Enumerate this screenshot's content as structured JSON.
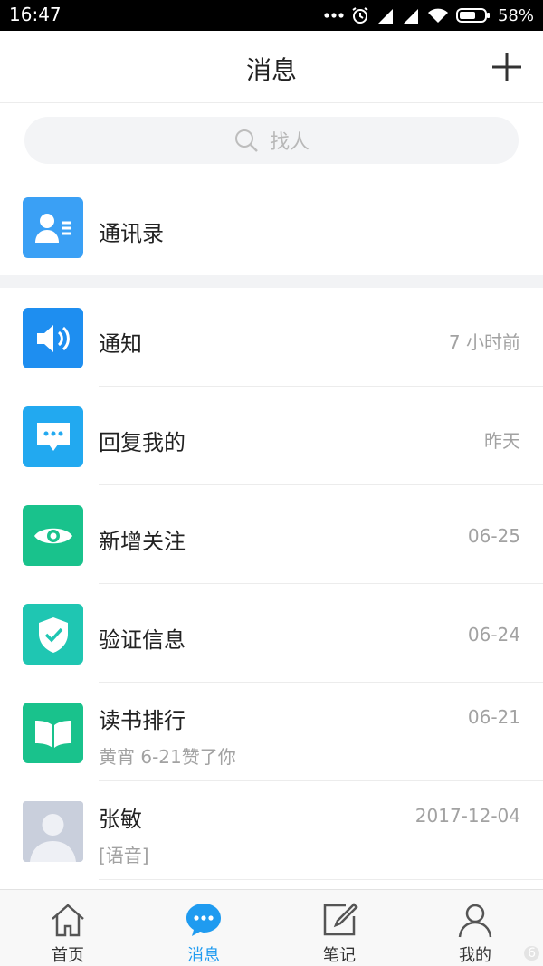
{
  "status_bar": {
    "time": "16:47",
    "battery": "58%"
  },
  "header": {
    "title": "消息",
    "add_icon": "plus-icon"
  },
  "search": {
    "placeholder": "找人",
    "icon": "search-icon"
  },
  "contacts": {
    "label": "通讯录",
    "icon": "contact-card-icon",
    "icon_color": "#3aa0f5"
  },
  "messages": [
    {
      "title": "通知",
      "time": "7 小时前",
      "icon": "speaker-icon",
      "icon_color": "#1e8ef0"
    },
    {
      "title": "回复我的",
      "time": "昨天",
      "icon": "chat-bubble-icon",
      "icon_color": "#22a9f0"
    },
    {
      "title": "新增关注",
      "time": "06-25",
      "icon": "eye-icon",
      "icon_color": "#19c28c"
    },
    {
      "title": "验证信息",
      "time": "06-24",
      "icon": "shield-check-icon",
      "icon_color": "#1fc6b2"
    },
    {
      "title": "读书排行",
      "time": "06-21",
      "subtitle": "黄宵 6-21赞了你",
      "icon": "book-icon",
      "icon_color": "#19c28c"
    },
    {
      "title": "张敏",
      "time": "2017-12-04",
      "subtitle": "[语音]",
      "icon": "avatar-placeholder-icon",
      "icon_color": "#c9cfdc"
    }
  ],
  "tab_bar": {
    "tabs": [
      {
        "label": "首页",
        "icon": "home-icon",
        "active": false
      },
      {
        "label": "消息",
        "icon": "message-icon",
        "active": true
      },
      {
        "label": "笔记",
        "icon": "note-icon",
        "active": false
      },
      {
        "label": "我的",
        "icon": "profile-icon",
        "active": false
      }
    ],
    "active_color": "#1f9bf0"
  },
  "watermark": "6"
}
